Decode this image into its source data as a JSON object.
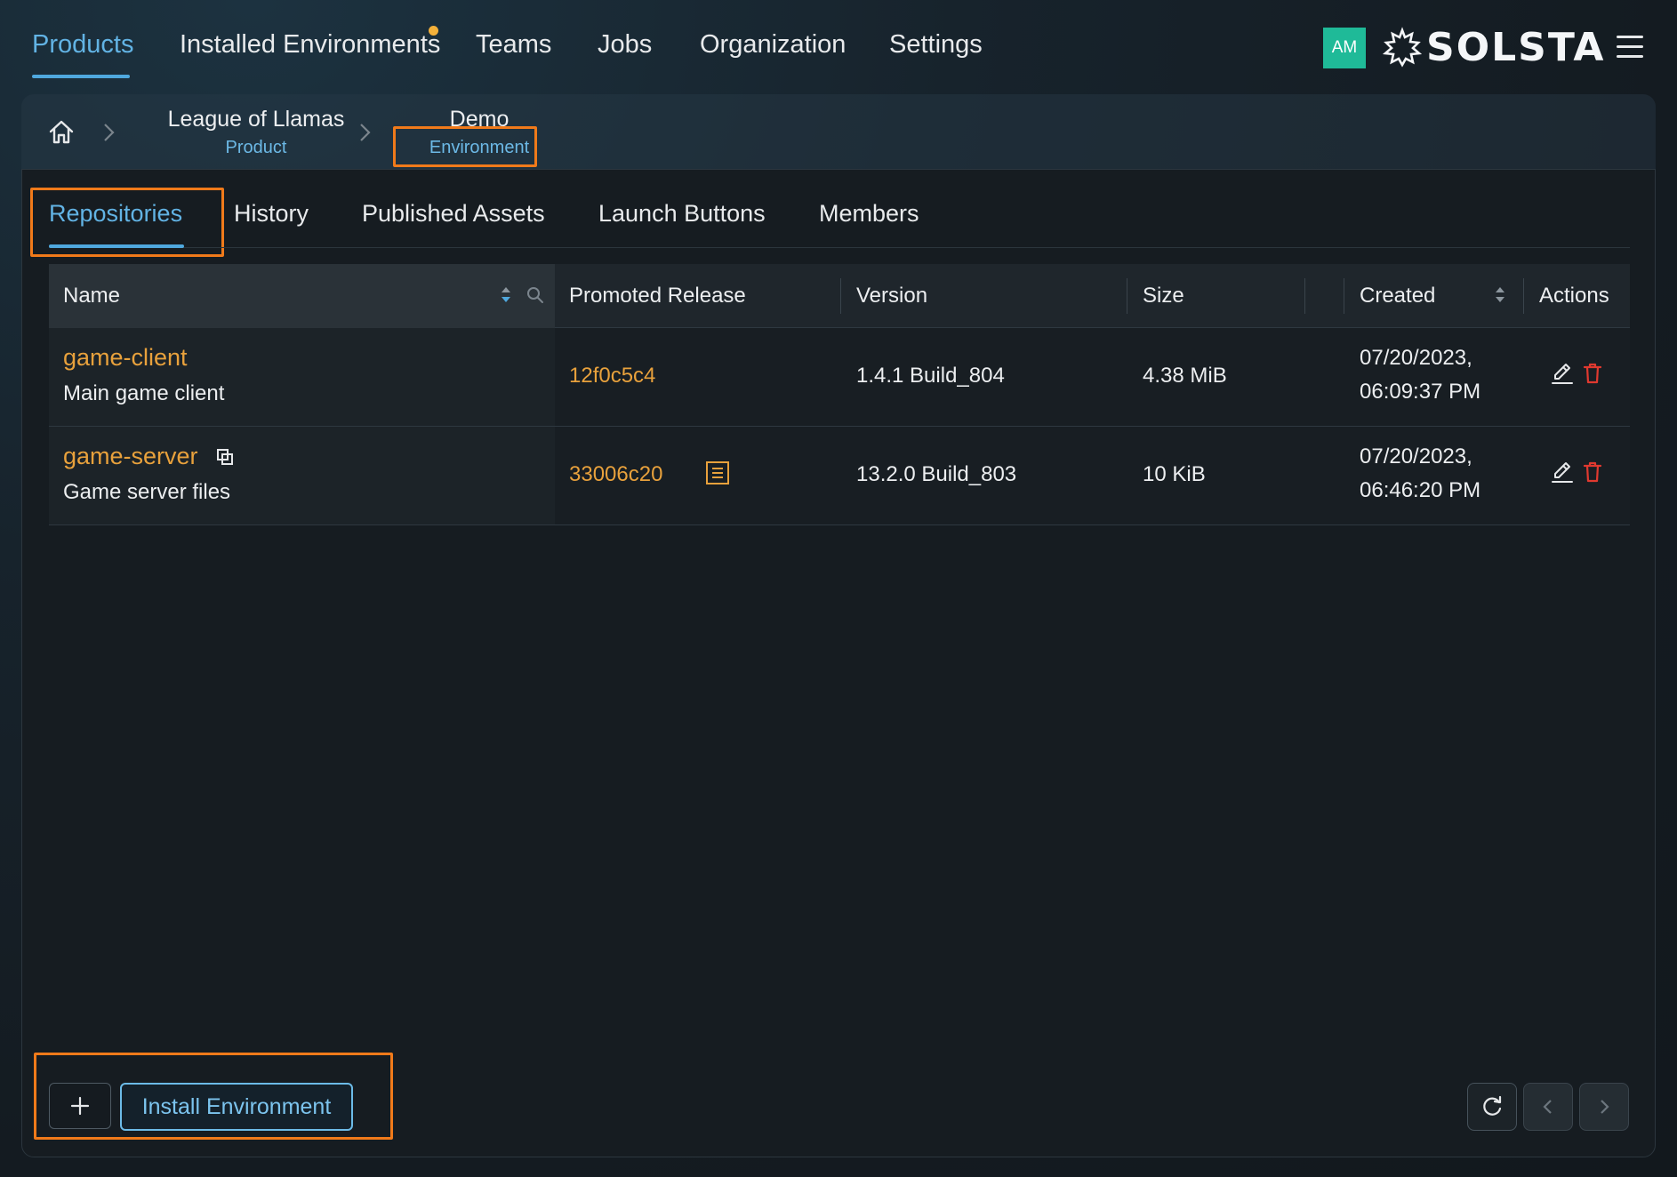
{
  "nav": {
    "items": [
      {
        "label": "Products",
        "active": true
      },
      {
        "label": "Installed Environments",
        "active": false,
        "has_notification": true
      },
      {
        "label": "Teams",
        "active": false
      },
      {
        "label": "Jobs",
        "active": false
      },
      {
        "label": "Organization",
        "active": false
      },
      {
        "label": "Settings",
        "active": false
      }
    ],
    "avatar_initials": "AM",
    "logo_text": "SOLSTA",
    "menu_icon": "hamburger-icon"
  },
  "breadcrumb": {
    "home_icon": "home-icon",
    "items": [
      {
        "title": "League of Llamas",
        "subtitle": "Product"
      },
      {
        "title": "Demo",
        "subtitle": "Environment"
      }
    ]
  },
  "tabs": [
    {
      "label": "Repositories",
      "active": true
    },
    {
      "label": "History",
      "active": false
    },
    {
      "label": "Published Assets",
      "active": false
    },
    {
      "label": "Launch Buttons",
      "active": false
    },
    {
      "label": "Members",
      "active": false
    }
  ],
  "table": {
    "columns": [
      "Name",
      "Promoted Release",
      "Version",
      "Size",
      "Created",
      "Actions"
    ],
    "rows": [
      {
        "name": "game-client",
        "description": "Main game client",
        "release": "12f0c5c4",
        "version": "1.4.1 Build_804",
        "size": "4.38 MiB",
        "created_date": "07/20/2023,",
        "created_time": "06:09:37 PM"
      },
      {
        "name": "game-server",
        "description": "Game server files",
        "release": "33006c20",
        "version": "13.2.0 Build_803",
        "size": "10 KiB",
        "created_date": "07/20/2023,",
        "created_time": "06:46:20 PM"
      }
    ]
  },
  "footer": {
    "install_label": "Install Environment"
  },
  "colors": {
    "accent": "#4fa8de",
    "link": "#e8a13c",
    "highlight": "#f07a1a",
    "avatar": "#1fba98",
    "delete": "#e0392f"
  }
}
